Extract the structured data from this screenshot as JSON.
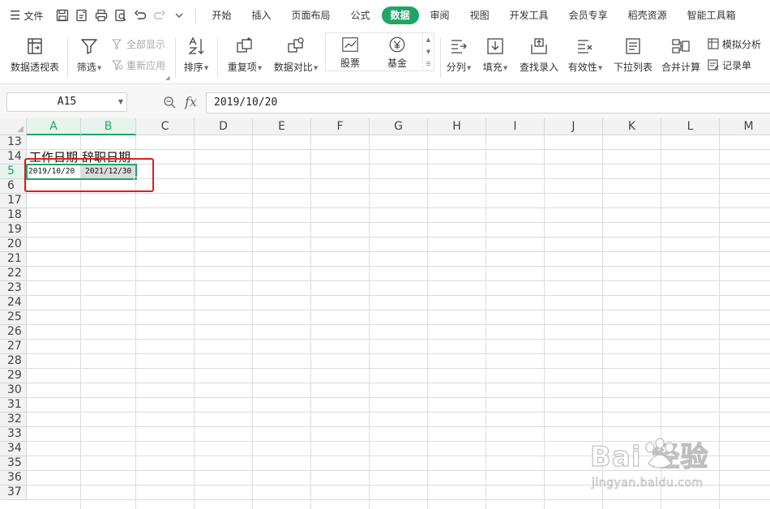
{
  "menu": {
    "file_label": "文件",
    "tabs": [
      {
        "label": "开始",
        "active": false
      },
      {
        "label": "插入",
        "active": false
      },
      {
        "label": "页面布局",
        "active": false
      },
      {
        "label": "公式",
        "active": false
      },
      {
        "label": "数据",
        "active": true
      },
      {
        "label": "审阅",
        "active": false
      },
      {
        "label": "视图",
        "active": false
      },
      {
        "label": "开发工具",
        "active": false
      },
      {
        "label": "会员专享",
        "active": false
      },
      {
        "label": "稻壳资源",
        "active": false
      },
      {
        "label": "智能工具箱",
        "active": false
      }
    ]
  },
  "ribbon": {
    "pivot": "数据透视表",
    "filter": "筛选",
    "show_all": "全部显示",
    "reapply": "重新应用",
    "sort": "排序",
    "duplicates": "重复项",
    "compare": "数据对比",
    "stock": "股票",
    "fund": "基金",
    "split": "分列",
    "fill": "填充",
    "lookup": "查找录入",
    "validity": "有效性",
    "dropdown": "下拉列表",
    "consolidate": "合并计算",
    "simulate": "模拟分析",
    "record": "记录单"
  },
  "formula_bar": {
    "name_box": "A15",
    "fx": "fx",
    "value": "2019/10/20"
  },
  "grid": {
    "columns": [
      "A",
      "B",
      "C",
      "D",
      "E",
      "F",
      "G",
      "H",
      "I",
      "J",
      "K",
      "L",
      "M"
    ],
    "rows": [
      "13",
      "14",
      "5",
      "6",
      "17",
      "18",
      "19",
      "20",
      "21",
      "22",
      "23",
      "24",
      "25",
      "26",
      "27",
      "28",
      "29",
      "30",
      "31",
      "32",
      "33",
      "34",
      "35",
      "36",
      "37"
    ],
    "cells": {
      "a14": "工作日期",
      "b14": "辞职日期",
      "a15": "2019/10/20",
      "b15": "2021/12/30"
    }
  },
  "watermark": {
    "main": "Bai  经验",
    "sub": "jingyan.baidu.com"
  },
  "colors": {
    "accent": "#1fa665",
    "highlight": "#e01d1d"
  }
}
